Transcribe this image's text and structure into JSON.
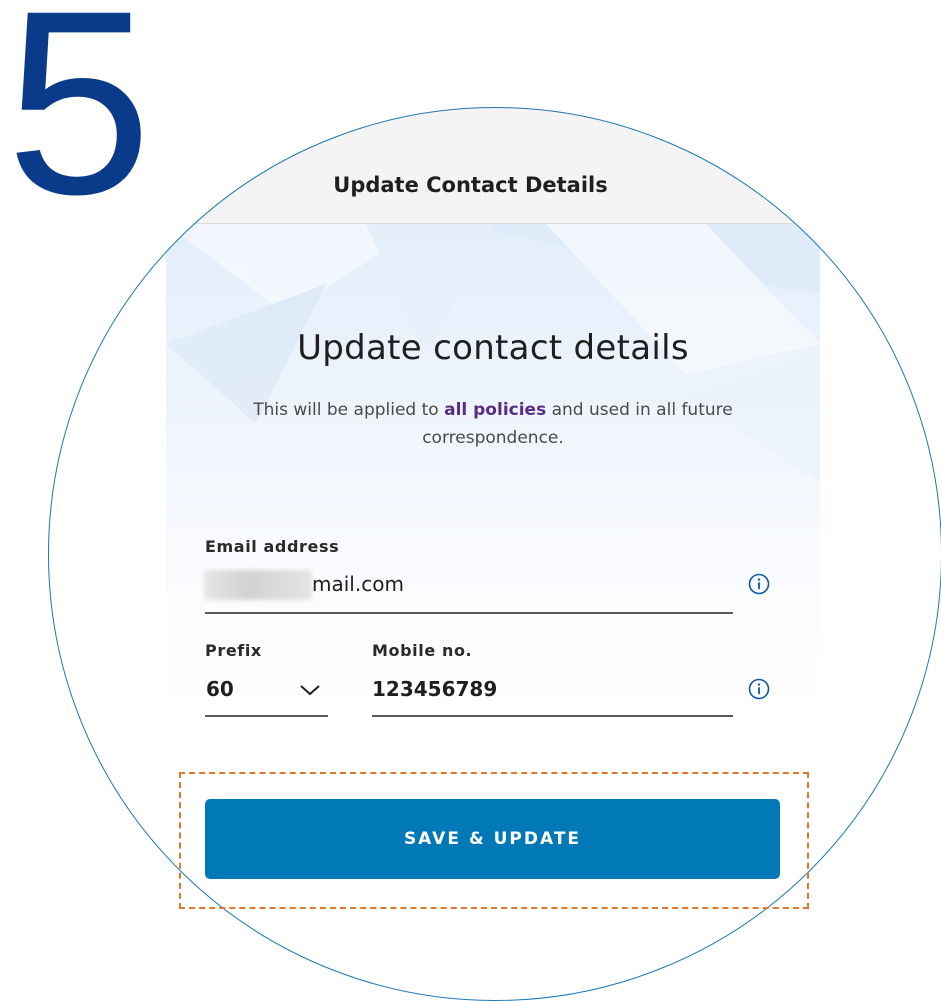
{
  "step": {
    "number": "5"
  },
  "header": {
    "title": "Update Contact Details"
  },
  "card": {
    "title": "Update contact details",
    "subtitle_before": "This will be applied to ",
    "subtitle_highlight": "all policies",
    "subtitle_after": " and used in all future correspondence."
  },
  "form": {
    "email": {
      "label": "Email address",
      "value": "mail.com",
      "info_icon": "info-icon"
    },
    "prefix": {
      "label": "Prefix",
      "value": "60",
      "dropdown_icon": "chevron-down-icon"
    },
    "mobile": {
      "label": "Mobile no.",
      "value": "123456789",
      "info_icon": "info-icon"
    }
  },
  "actions": {
    "save_label": "SAVE & UPDATE"
  },
  "colors": {
    "step_number": "#0a3b8a",
    "circle_outline": "#1c79b3",
    "primary_button": "#0179b6",
    "highlight_text": "#5a2d84",
    "callout_outline": "#e07828"
  }
}
